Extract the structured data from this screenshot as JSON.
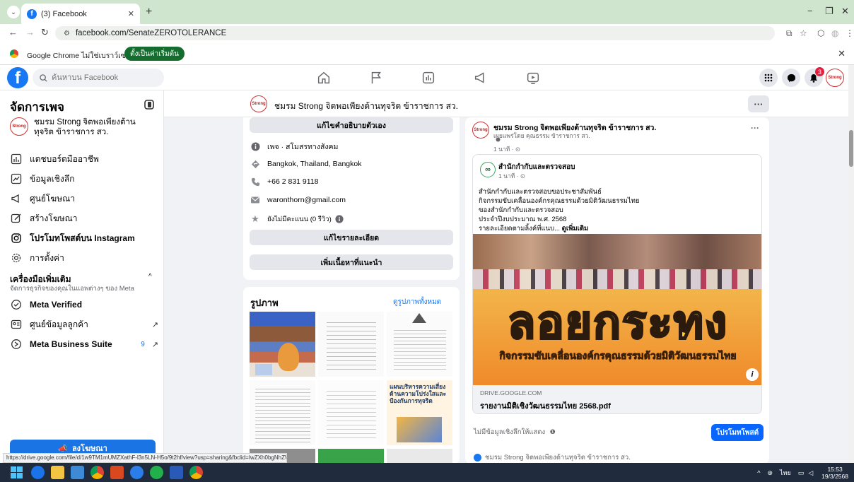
{
  "browser": {
    "tab_title": "(3) Facebook",
    "url": "facebook.com/SenateZEROTOLERANCE",
    "infobar_message": "Google Chrome ไม่ใช่เบราว์เซอร์เริ่มต้น",
    "infobar_button": "ตั้งเป็นค่าเริ่มต้น",
    "accent_color": "#cfe5cd"
  },
  "facebook": {
    "search_placeholder": "ค้นหาบน Facebook",
    "notification_count": "3",
    "brand_color": "#1877f2"
  },
  "sidebar": {
    "title": "จัดการเพจ",
    "page_name": "ชมรม Strong จิตพอเพียงต้านทุจริต ข้าราชการ สว.",
    "items": [
      {
        "label": "แดชบอร์ดมืออาชีพ",
        "icon": "dashboard-icon"
      },
      {
        "label": "ข้อมูลเชิงลึก",
        "icon": "insights-icon"
      },
      {
        "label": "ศูนย์โฆษณา",
        "icon": "megaphone-icon"
      },
      {
        "label": "สร้างโฆษณา",
        "icon": "pencil-icon"
      },
      {
        "label": "โปรโมทโพสต์บน Instagram",
        "icon": "instagram-icon"
      },
      {
        "label": "การตั้งค่า",
        "icon": "gear-icon"
      }
    ],
    "tools_heading": "เครื่องมือเพิ่มเติม",
    "tools_subtitle": "จัดการธุรกิจของคุณในแอพต่างๆ ของ Meta",
    "tools": [
      {
        "label": "Meta Verified",
        "icon": "verified-icon"
      },
      {
        "label": "ศูนย์ข้อมูลลูกค้า",
        "icon": "contacts-icon"
      },
      {
        "label": "Meta Business Suite",
        "icon": "meta-icon",
        "count": "9"
      }
    ],
    "promote_button": "ลงโฆษณา"
  },
  "page_header": {
    "title": "ชมรม Strong จิตพอเพียงต้านทุจริต ข้าราชการ สว.",
    "more": "···"
  },
  "intro": {
    "edit_bio": "แก้ไขคำอธิบายตัวเอง",
    "category": "เพจ · สโมสรทางสังคม",
    "address": "Bangkok, Thailand, Bangkok",
    "phone": "+66 2 831 9118",
    "email": "waronthorn@gmail.com",
    "rating": "ยังไม่มีคะแนน (0 รีวิว)",
    "edit_details": "แก้ไขรายละเอียด",
    "add_featured": "เพิ่มเนื้อหาที่แนะนำ"
  },
  "photos": {
    "heading": "รูปภาพ",
    "see_all": "ดูรูปภาพทั้งหมด",
    "thumb5_text": "แผนบริหารความเสี่ยงด้านความโปร่งใสและป้องกันการทุจริต"
  },
  "post": {
    "author": "ชมรม Strong จิตพอเพียงต้านทุจริต ข้าราชการ สว.",
    "posted_by": "เผยแพร่โดย คุณธรรม ข้าราชการ สว.",
    "time": "1 นาที · ",
    "more": "···",
    "shared_author": "สำนักกำกับและตรวจสอบ",
    "shared_time": "1 นาที · ",
    "lines": [
      "สำนักกำกับและตรวจสอบขอประชาสัมพันธ์",
      "กิจกรรมขับเคลื่อนองค์กรคุณธรรมด้วยมิติวัฒนธรรมไทย",
      "ของสำนักกำกับและตรวจสอบ",
      "ประจำปีงบประมาณ พ.ศ. 2568"
    ],
    "last_line": "รายละเอียดตามลิ้งค์ที่แนบ... ",
    "see_more": "ดูเพิ่มเติม",
    "banner_title": "ลอยกระทง",
    "banner_subtitle": "กิจกรรมขับเคลื่อนองค์กรคุณธรรมด้วยมิติวัฒนธรรมไทย",
    "link_domain": "DRIVE.GOOGLE.COM",
    "link_title": "รายงานมิติเชิงวัฒนธรรมไทย 2568.pdf",
    "insights_text": "ไม่มีข้อมูลเชิงลึกให้แสดง",
    "boost_button": "โปรโมทโพสต์",
    "commenter": "ชมรม Strong จิตพอเพียงต้านทุจริต ข้าราชการ สว."
  },
  "status_url": "https://drive.google.com/file/d/1w9TM1mUMZXathF-l3n5LN-H5o/9t2hf/view?usp=sharing&fbclid=IwZXh0bgNhZW...",
  "taskbar": {
    "lang": "ไทย",
    "time": "15:53",
    "date": "19/3/2568"
  }
}
